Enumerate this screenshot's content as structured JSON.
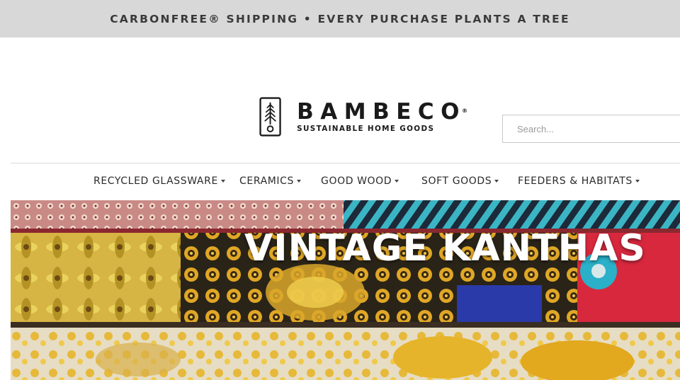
{
  "announcement": {
    "text": "CARBONFREE® SHIPPING • EVERY PURCHASE PLANTS A TREE"
  },
  "brand": {
    "name": "BAMBECO",
    "registered": "®",
    "tagline": "SUSTAINABLE HOME GOODS",
    "icon": "tree-logo-icon"
  },
  "search": {
    "placeholder": "Search...",
    "value": ""
  },
  "nav": {
    "items": [
      {
        "label": "RECYCLED GLASSWARE",
        "icon": "caret-down-icon"
      },
      {
        "label": "CERAMICS",
        "icon": "caret-down-icon"
      },
      {
        "label": "GOOD WOOD",
        "icon": "caret-down-icon"
      },
      {
        "label": "SOFT GOODS",
        "icon": "caret-down-icon"
      },
      {
        "label": "FEEDERS & HABITATS",
        "icon": "caret-down-icon"
      }
    ]
  },
  "hero": {
    "title": "VINTAGE KANTHAS"
  },
  "colors": {
    "announcement_bg": "#d8d8d8",
    "text_dark": "#1a1a1a",
    "hero_text": "#ffffff"
  }
}
